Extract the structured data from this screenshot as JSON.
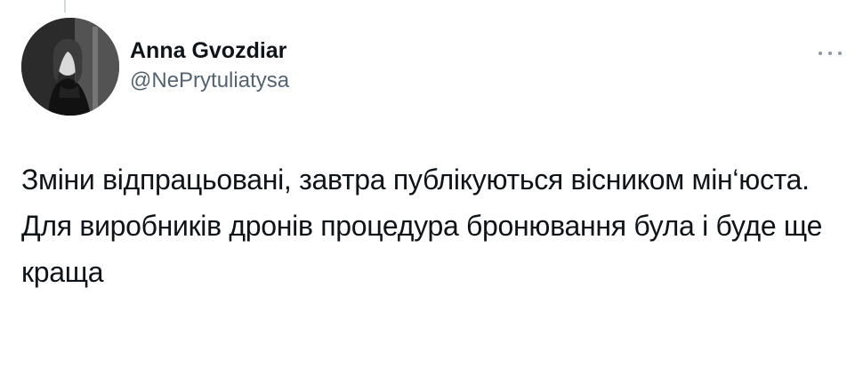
{
  "author": {
    "display_name": "Anna Gvozdiar",
    "handle": "@NePrytuliatysa",
    "avatar_icon": "profile-photo"
  },
  "more_icon": "ellipsis-icon",
  "tweet": {
    "paragraphs": [
      "Зміни відпрацьовані, завтра публікуються вісником мін‘юста.",
      "Для виробників дронів процедура бронювання була і буде ще краща"
    ]
  },
  "colors": {
    "text": "#0f1419",
    "secondary": "#536471",
    "divider": "#cfd9de"
  }
}
